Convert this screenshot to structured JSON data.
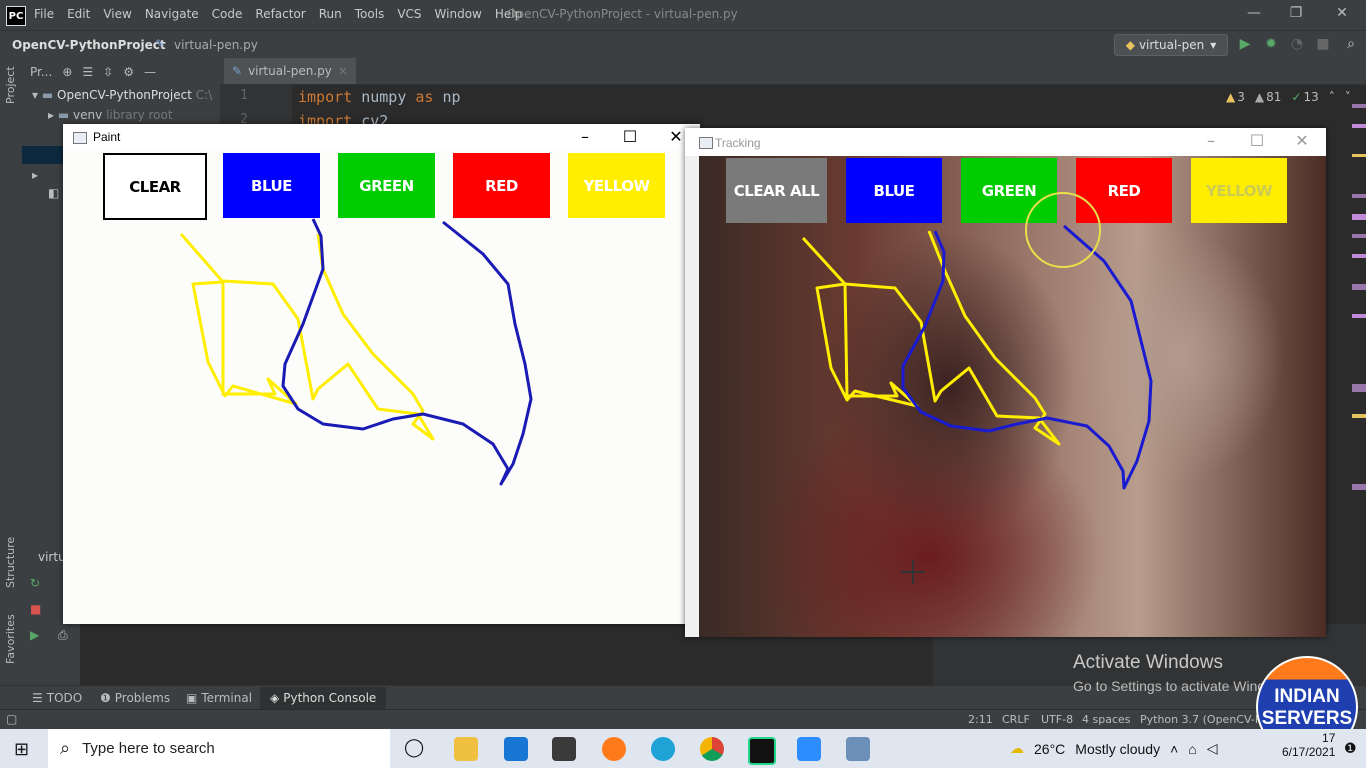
{
  "ide": {
    "menu": [
      "File",
      "Edit",
      "View",
      "Navigate",
      "Code",
      "Refactor",
      "Run",
      "Tools",
      "VCS",
      "Window",
      "Help"
    ],
    "title": "OpenCV-PythonProject - virtual-pen.py",
    "breadcrumb_project": "OpenCV-PythonProject",
    "breadcrumb_file": "virtual-pen.py",
    "run_config": "virtual-pen",
    "project_tool": "Pr...",
    "project_root": "OpenCV-PythonProject",
    "project_root_path": "C:\\",
    "venv_label": "venv",
    "venv_suffix": "library root",
    "editor_tab": "virtual-pen.py",
    "line1_no": "1",
    "line2_no": "2",
    "code_line1": [
      "import",
      " numpy ",
      "as",
      " np"
    ],
    "code_line2": [
      "import",
      " cv2"
    ],
    "warnings": {
      "warn": "3",
      "weak": "81",
      "ok": "13"
    },
    "left_labels": {
      "project": "Project",
      "structure": "Structure",
      "favorites": "Favorites"
    },
    "console_tab": "virtu",
    "bottom_tabs": [
      "TODO",
      "Problems",
      "Terminal",
      "Python Console"
    ],
    "status": {
      "pos": "2:11",
      "eol": "CRLF",
      "enc": "UTF-8",
      "indent": "4 spaces",
      "interp": "Python 3.7 (OpenCV-P"
    }
  },
  "paint": {
    "title": "Paint",
    "buttons": [
      {
        "label": "CLEAR",
        "color": "#ffffff"
      },
      {
        "label": "BLUE",
        "color": "#0000ff"
      },
      {
        "label": "GREEN",
        "color": "#00cc00"
      },
      {
        "label": "RED",
        "color": "#ff0000"
      },
      {
        "label": "YELLOW",
        "color": "#ffee00"
      }
    ]
  },
  "tracking": {
    "title": "Tracking",
    "buttons": [
      {
        "label": "CLEAR ALL",
        "color": "#7a7a7a"
      },
      {
        "label": "BLUE",
        "color": "#0000ff"
      },
      {
        "label": "GREEN",
        "color": "#00cc00"
      },
      {
        "label": "RED",
        "color": "#ff0000"
      },
      {
        "label": "YELLOW",
        "color": "#ffee00"
      }
    ]
  },
  "activation": {
    "title": "Activate Windows",
    "subtitle": "Go to Settings to activate Windows."
  },
  "logo": {
    "line1": "INDIAN",
    "line2": "SERVERS"
  },
  "taskbar": {
    "search_placeholder": "Type here to search",
    "weather_temp": "26°C",
    "weather_text": "Mostly cloudy",
    "time": "17",
    "date": "6/17/2021"
  }
}
